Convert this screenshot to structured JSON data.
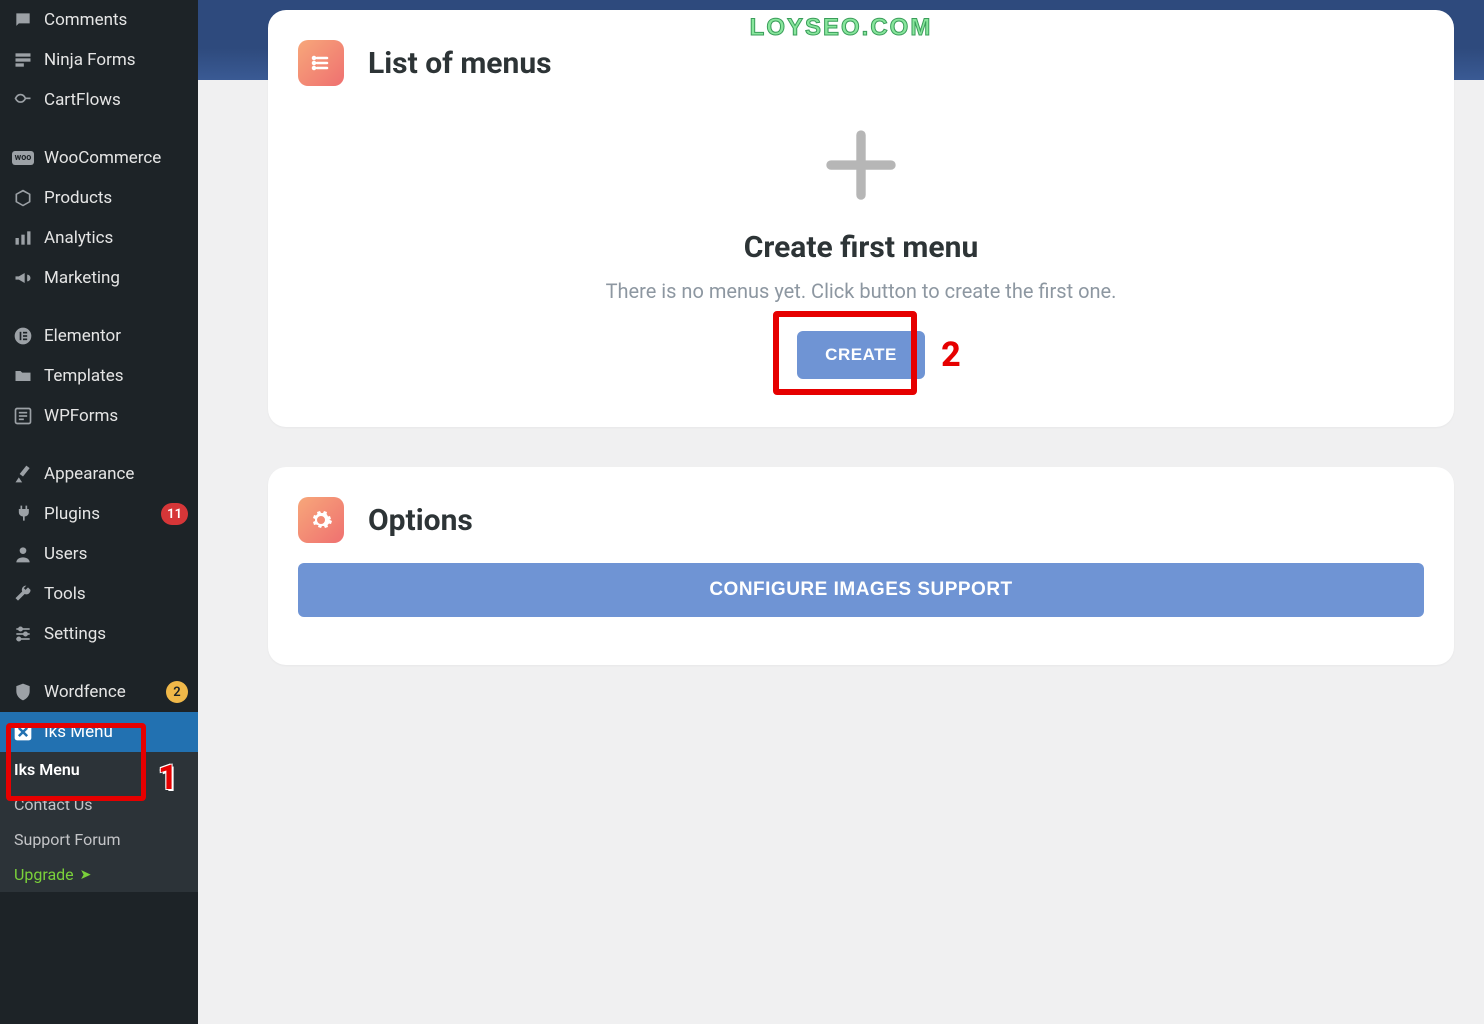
{
  "watermark": "LOYSEO.COM",
  "sidebar": {
    "items": [
      {
        "label": "Comments"
      },
      {
        "label": "Ninja Forms"
      },
      {
        "label": "CartFlows"
      },
      {
        "label": "WooCommerce"
      },
      {
        "label": "Products"
      },
      {
        "label": "Analytics"
      },
      {
        "label": "Marketing"
      },
      {
        "label": "Elementor"
      },
      {
        "label": "Templates"
      },
      {
        "label": "WPForms"
      },
      {
        "label": "Appearance"
      },
      {
        "label": "Plugins",
        "badge": "11"
      },
      {
        "label": "Users"
      },
      {
        "label": "Tools"
      },
      {
        "label": "Settings"
      },
      {
        "label": "Wordfence",
        "badge": "2"
      },
      {
        "label": "Iks Menu"
      }
    ],
    "submenu": {
      "items": [
        {
          "label": "Iks Menu"
        },
        {
          "label": "Contact Us"
        },
        {
          "label": "Support Forum"
        },
        {
          "label": "Upgrade"
        }
      ]
    }
  },
  "cards": {
    "menus": {
      "title": "List of menus",
      "empty_title": "Create first menu",
      "empty_sub": "There is no menus yet. Click button to create the first one.",
      "create_label": "CREATE"
    },
    "options": {
      "title": "Options",
      "configure_label": "CONFIGURE IMAGES SUPPORT"
    }
  },
  "annotations": {
    "label_1": "1",
    "label_2": "2"
  }
}
